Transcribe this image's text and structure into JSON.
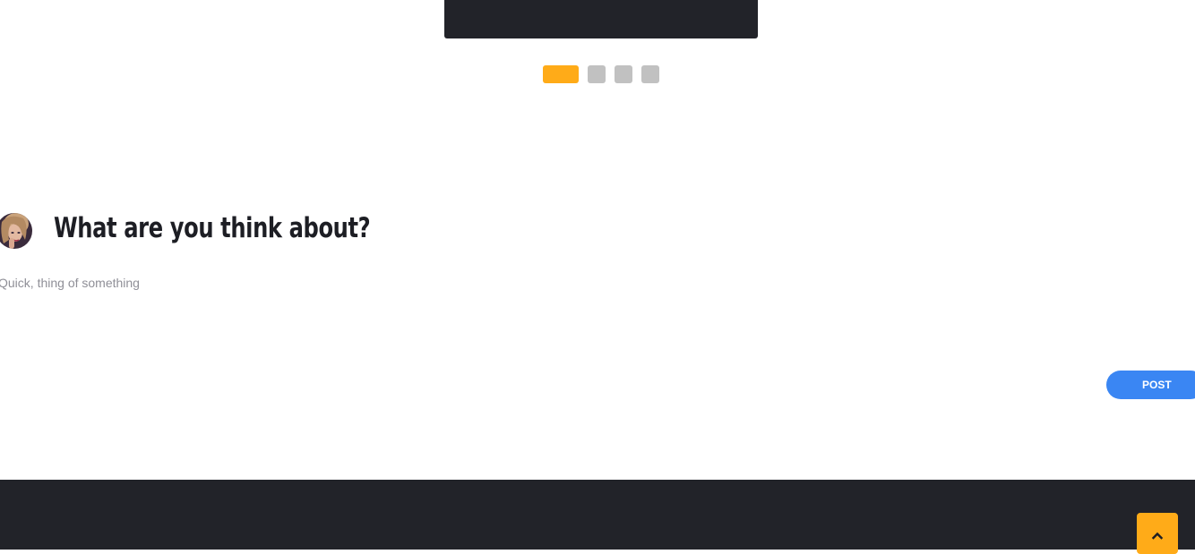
{
  "carousel": {
    "dots": [
      {
        "active": true
      },
      {
        "active": false
      },
      {
        "active": false
      },
      {
        "active": false
      }
    ]
  },
  "comment_form": {
    "heading": "What are you think about?",
    "placeholder": "Quick, thing of something",
    "post_label": "POST"
  },
  "icons": {
    "avatar": "user-avatar",
    "scroll_top": "chevron-up-icon"
  },
  "colors": {
    "accent": "#ffab18",
    "primary_button": "#3a86f3",
    "dark": "#222329",
    "dot_inactive": "#c1c1c1"
  }
}
